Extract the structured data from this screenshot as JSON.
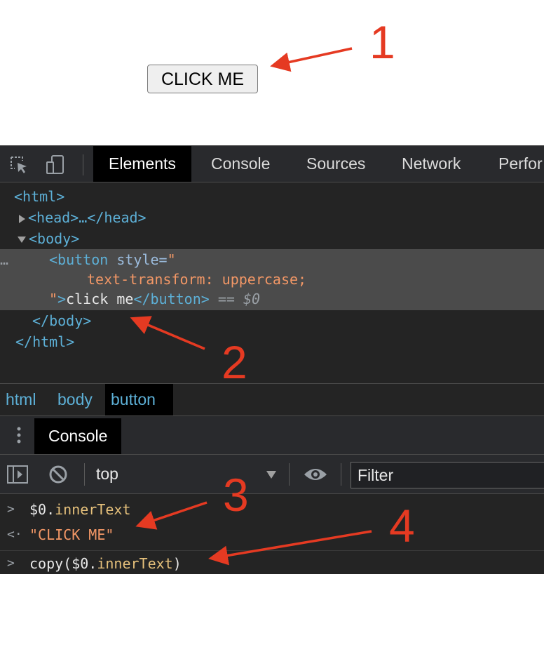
{
  "page": {
    "button_label": "CLICK ME"
  },
  "devtools": {
    "tabs": [
      "Elements",
      "Console",
      "Sources",
      "Network",
      "Perfor"
    ],
    "active_tab": "Elements",
    "dom": {
      "html_open": "<html>",
      "head": "<head>…</head>",
      "body_open": "<body>",
      "button_open": "<button",
      "style_attr": " style=",
      "style_quote_open": "\"",
      "style_value": "text-transform: uppercase;",
      "style_quote_close": "\"",
      "button_close_bracket": ">",
      "button_text": "click me",
      "button_close": "</button>",
      "selected_marker": " == $0",
      "body_close": "</body>",
      "html_close": "</html>",
      "ellipsis": "…"
    },
    "breadcrumb": [
      "html",
      "body",
      "button"
    ],
    "drawer": {
      "tab": "Console"
    },
    "console": {
      "context": "top",
      "filter_placeholder": "Filter",
      "lines": [
        {
          "prompt": ">",
          "prefix": "$0.",
          "prop": "innerText",
          "suffix": ""
        },
        {
          "prompt": "<·",
          "result": "\"CLICK ME\""
        },
        {
          "prompt": ">",
          "prefix": "copy($0.",
          "prop": "innerText",
          "suffix": ")"
        }
      ]
    }
  },
  "annotations": {
    "color": "#e53a22",
    "labels": [
      "1",
      "2",
      "3",
      "4"
    ]
  }
}
